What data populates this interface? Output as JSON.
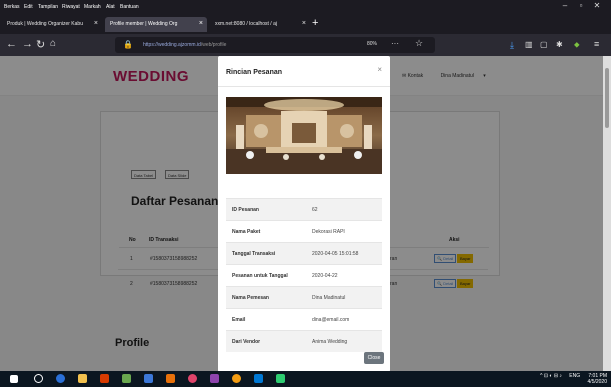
{
  "menubar": {
    "items": [
      "Berkas",
      "Edit",
      "Tampilan",
      "Riwayat",
      "Markah",
      "Alat",
      "Bantuan"
    ]
  },
  "browser": {
    "tabs": [
      {
        "title": "Produk | Wedding Organizer Kabu",
        "active": false
      },
      {
        "title": "Profile member | Wedding Org",
        "active": true
      },
      {
        "title": "xxm.net:8080 / localhost / aj",
        "active": false
      }
    ],
    "url_host": "https://wedding.ajzomm.id",
    "url_path": "/web/profile",
    "zoom": "80%"
  },
  "site": {
    "logo": "WEDDING",
    "nav_contact": "Kontak",
    "nav_user": "Dina Madinatul"
  },
  "orders": {
    "filter_buttons": [
      "Data Tabel",
      "Data Slide"
    ],
    "title": "Daftar Pesanan",
    "columns": [
      "No",
      "ID Transaksi",
      "Aksi"
    ],
    "rows": [
      {
        "no": "1",
        "id": "#1580373158988252",
        "partial": "ran",
        "detail": "Detail",
        "pay": "Bayar"
      },
      {
        "no": "2",
        "id": "#1580373158988252",
        "partial": "ran",
        "detail": "Detail",
        "pay": "Bayar"
      }
    ]
  },
  "profile": {
    "title": "Profile"
  },
  "modal": {
    "title": "Rincian Pesanan",
    "close_symbol": "×",
    "rows": [
      {
        "label": "ID Pesanan",
        "value": "62"
      },
      {
        "label": "Nama Paket",
        "value": "Dekorasi RAPI"
      },
      {
        "label": "Tanggal Transaksi",
        "value": "2020-04-05 15:01:58"
      },
      {
        "label": "Pesanan untuk Tanggal",
        "value": "2020-04-22"
      },
      {
        "label": "Nama Pemesan",
        "value": "Dina Madinatul"
      },
      {
        "label": "Email",
        "value": "dina@email.com"
      },
      {
        "label": "Dari Vendor",
        "value": "Anima Wedding"
      }
    ],
    "close_button": "Close"
  },
  "taskbar": {
    "time": "7:01 PM",
    "date": "4/5/2020",
    "lang": "ENG"
  },
  "colors": {
    "brand": "#c2185b",
    "pay": "#f0c000",
    "detail": "#5a8fd1",
    "close": "#6c757d"
  }
}
